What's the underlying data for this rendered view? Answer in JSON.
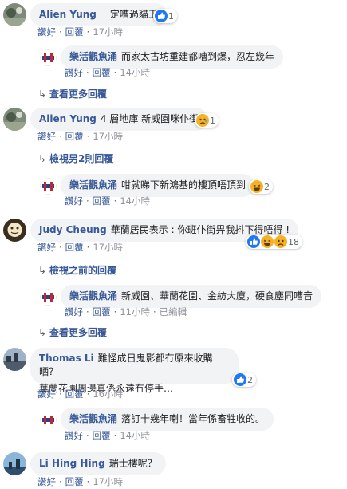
{
  "actions": {
    "like": "讚好",
    "reply": "回覆",
    "sep": "·"
  },
  "comments": [
    {
      "author": "Alien Yung",
      "text": "一定嘈過貓王",
      "time": "17小時",
      "reaction_count": "1"
    },
    {
      "author": "樂活觀魚涌",
      "text": "而家太古坊重建都嘈到爆，忍左幾年",
      "time": "14小時"
    },
    {
      "more": "查看更多回覆"
    },
    {
      "author": "Alien Yung",
      "text": "4 層地庫 新威園咪仆街",
      "time": "17小時",
      "reaction_count": "1"
    },
    {
      "more": "檢視另2則回覆"
    },
    {
      "author": "樂活觀魚涌",
      "text": "咁就睇下新鴻基的樓頂唔頂到",
      "time": "14小時",
      "reaction_count": "2"
    },
    {
      "author": "Judy Cheung",
      "text": "華蘭居民表示 : 你班仆街畀我抖下得唔得 !",
      "time": "17小時",
      "reaction_count": "18"
    },
    {
      "more": "檢視之前的回覆"
    },
    {
      "author": "樂活觀魚涌",
      "text": "新威園、華蘭花園、金紡大廈，硬食塵同嘈音",
      "time": "11小時",
      "edited": "已編輯"
    },
    {
      "more": "查看更多回覆"
    },
    {
      "author": "Thomas Li",
      "text": "難怪成日鬼影都冇原來收購晒？",
      "text2": "華蘭花園周邊真係永遠冇停手…",
      "time": "16小時",
      "reaction_count": "2"
    },
    {
      "author": "樂活觀魚涌",
      "text": "落訂十幾年喇！當年係畜牲收的。",
      "time": "14小時"
    },
    {
      "author": "Li Hing Hing",
      "text": "瑞士樓呢？",
      "time": "17小時"
    }
  ],
  "colors": {
    "link": "#385898",
    "bubble": "#f2f3f5",
    "meta": "#606770",
    "like_blue": "#2078f4",
    "haha_yellow": "#f7b125"
  }
}
